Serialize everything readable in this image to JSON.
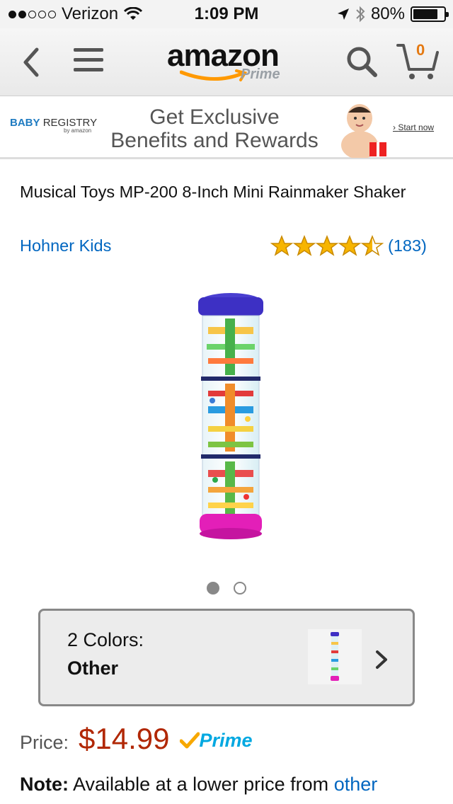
{
  "status_bar": {
    "carrier": "Verizon",
    "time": "1:09 PM",
    "battery": "80%",
    "battery_level": 0.8,
    "signal_bars": 2
  },
  "nav": {
    "logo_text": "amazon",
    "logo_sub": "Prime",
    "cart_count": "0",
    "icons": [
      "back-chevron-icon",
      "hamburger-menu-icon",
      "search-icon",
      "cart-icon"
    ]
  },
  "banner": {
    "registry_brand": "BABY",
    "registry_word": "REGISTRY",
    "registry_by": "by amazon",
    "headline_1": "Get Exclusive",
    "headline_2": "Benefits and Rewards",
    "cta": "Start now"
  },
  "product": {
    "title": "Musical Toys MP-200 8-Inch Mini Rainmaker Shaker",
    "brand": "Hohner Kids",
    "rating": 4.5,
    "review_count": "(183)",
    "image_pages": 2,
    "image_page_active": 1
  },
  "variation": {
    "count_label": "2 Colors:",
    "selected": "Other"
  },
  "pricing": {
    "label": "Price:",
    "value": "$14.99",
    "prime": "Prime"
  },
  "note": {
    "label": "Note:",
    "text": " Available at a lower price from ",
    "link": "other"
  },
  "colors": {
    "accent_orange": "#e47911",
    "link_blue": "#0066c0",
    "price_red": "#b12704",
    "star_gold": "#f7b500",
    "prime_blue": "#00a8e1"
  }
}
